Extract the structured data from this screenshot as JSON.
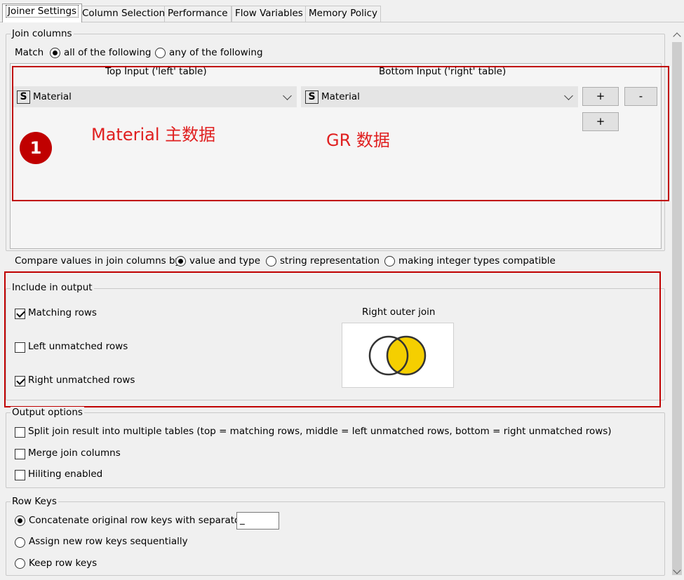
{
  "tabs": [
    {
      "label": "Joiner Settings",
      "active": true
    },
    {
      "label": "Column Selection"
    },
    {
      "label": "Performance"
    },
    {
      "label": "Flow Variables"
    },
    {
      "label": "Memory Policy"
    }
  ],
  "join_columns": {
    "legend": "Join columns",
    "match_label": "Match",
    "match_all": "all of the following",
    "match_any": "any of the following",
    "match_selected": "all of the following",
    "top_header": "Top Input ('left' table)",
    "bottom_header": "Bottom Input ('right' table)",
    "left_column": {
      "type": "S",
      "value": "Material"
    },
    "right_column": {
      "type": "S",
      "value": "Material"
    },
    "add_label": "+",
    "remove_label": "-",
    "add2_label": "+"
  },
  "annotation": {
    "number": "1",
    "left_text": "Material 主数据",
    "right_text": "GR 数据",
    "color": "#c00000"
  },
  "compare": {
    "label": "Compare values in join columns by",
    "options": [
      "value and type",
      "string representation",
      "making integer types compatible"
    ],
    "selected": "value and type"
  },
  "include_output": {
    "legend": "Include in output",
    "matching_rows": "Matching rows",
    "matching_checked": true,
    "left_unmatched": "Left unmatched rows",
    "left_checked": false,
    "right_unmatched": "Right unmatched rows",
    "right_checked": true,
    "join_type_label": "Right outer join",
    "venn_fill": "#f5cf00"
  },
  "output_options": {
    "legend": "Output options",
    "split": "Split join result into multiple tables (top = matching rows, middle = left unmatched rows, bottom = right unmatched rows)",
    "merge": "Merge join columns",
    "hiliting": "Hiliting enabled"
  },
  "row_keys": {
    "legend": "Row Keys",
    "concatenate": "Concatenate original row keys with separator",
    "separator_value": "_",
    "assign_new": "Assign new row keys sequentially",
    "keep": "Keep row keys",
    "selected": "Concatenate original row keys with separator"
  }
}
